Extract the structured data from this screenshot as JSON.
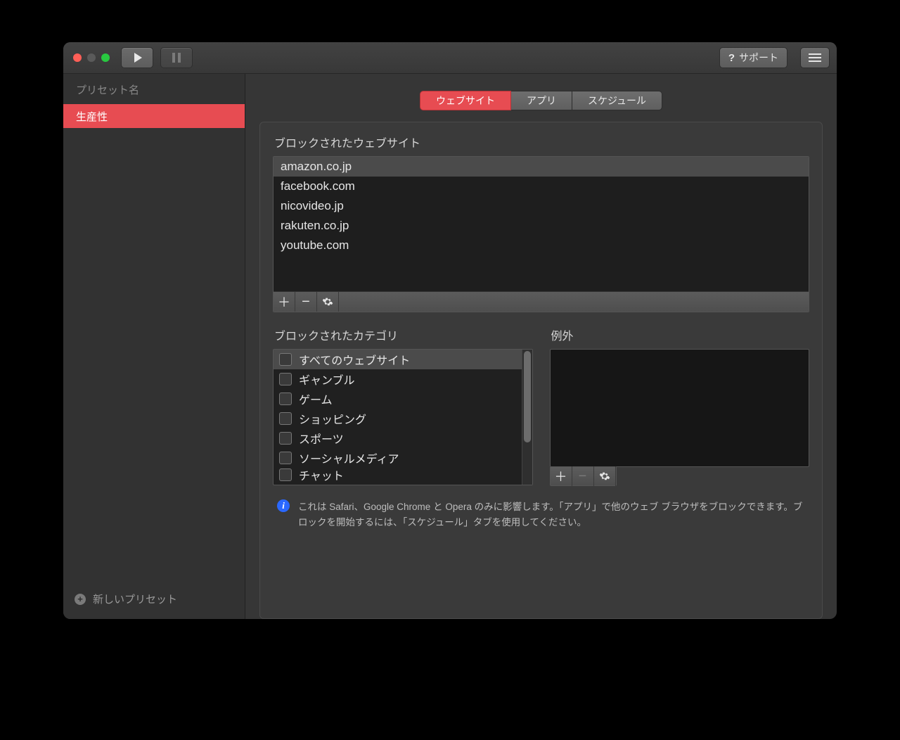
{
  "titlebar": {
    "support_label": "サポート"
  },
  "sidebar": {
    "header": "プリセット名",
    "presets": [
      {
        "label": "生産性",
        "selected": true
      }
    ],
    "new_preset_label": "新しいプリセット"
  },
  "tabs": {
    "items": [
      {
        "label": "ウェブサイト",
        "active": true
      },
      {
        "label": "アプリ",
        "active": false
      },
      {
        "label": "スケジュール",
        "active": false
      }
    ]
  },
  "sections": {
    "blocked_sites_label": "ブロックされたウェブサイト",
    "blocked_categories_label": "ブロックされたカテゴリ",
    "exceptions_label": "例外"
  },
  "blocked_sites": [
    {
      "domain": "amazon.co.jp",
      "selected": true
    },
    {
      "domain": "facebook.com",
      "selected": false
    },
    {
      "domain": "nicovideo.jp",
      "selected": false
    },
    {
      "domain": "rakuten.co.jp",
      "selected": false
    },
    {
      "domain": "youtube.com",
      "selected": false
    }
  ],
  "categories": [
    {
      "label": "すべてのウェブサイト",
      "checked": false,
      "selected": true
    },
    {
      "label": "ギャンブル",
      "checked": false
    },
    {
      "label": "ゲーム",
      "checked": false
    },
    {
      "label": "ショッピング",
      "checked": false
    },
    {
      "label": "スポーツ",
      "checked": false
    },
    {
      "label": "ソーシャルメディア",
      "checked": false
    },
    {
      "label": "チャット",
      "checked": false
    }
  ],
  "info_note": "これは Safari、Google Chrome と Opera のみに影響します。「アプリ」で他のウェブ ブラウザをブロックできます。ブロックを開始するには、「スケジュール」タブを使用してください。"
}
